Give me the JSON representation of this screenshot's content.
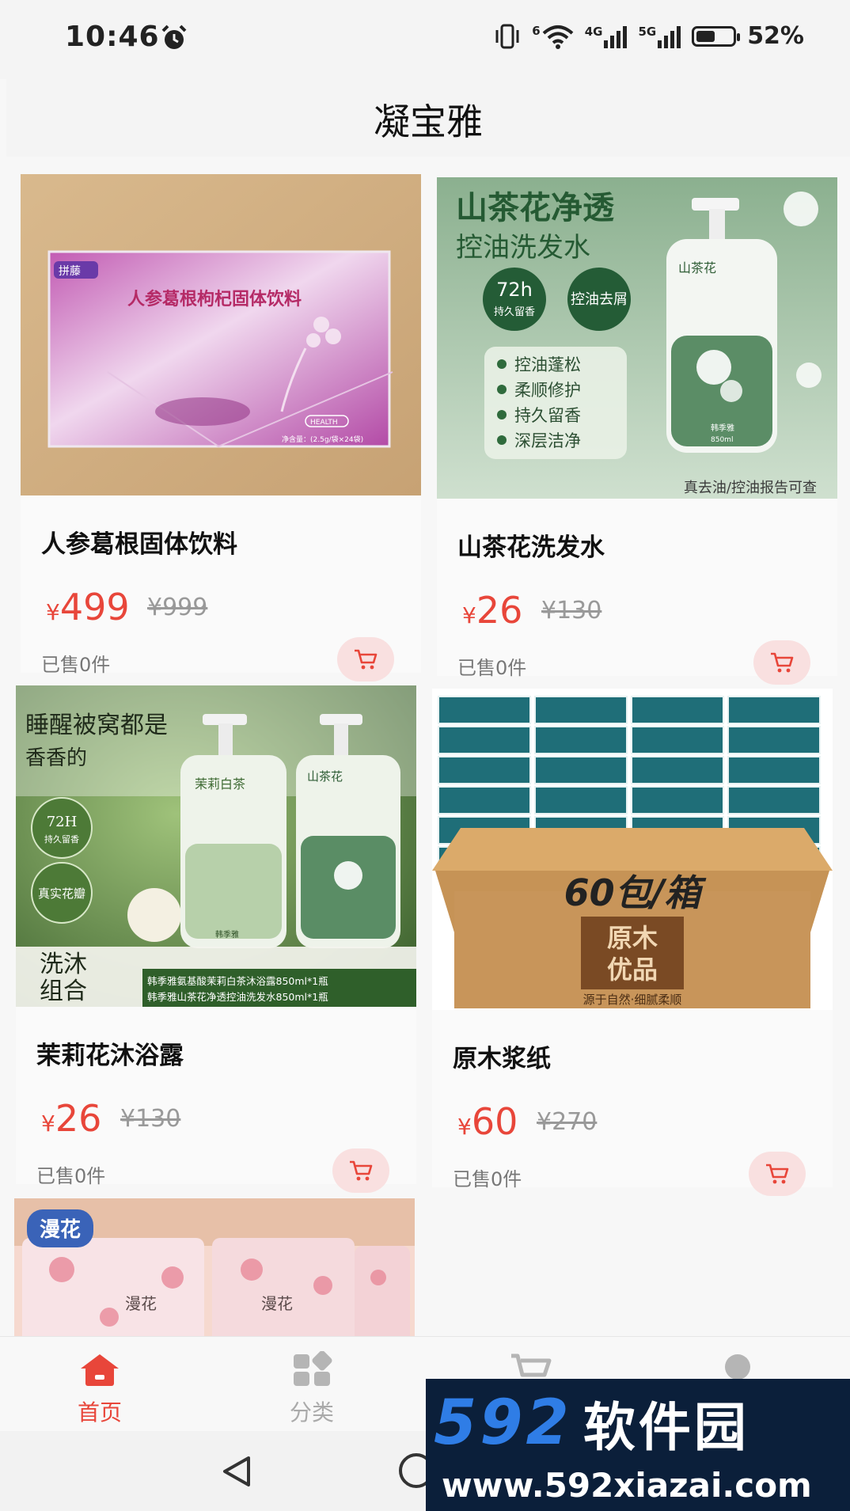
{
  "status_bar": {
    "time": "10:46",
    "network_labels": [
      "6",
      "4G",
      "5G"
    ],
    "battery_percent": "52%",
    "battery_level": 0.52
  },
  "header": {
    "title": "凝宝雅"
  },
  "currency_symbol": "¥",
  "products": [
    {
      "name": "人参葛根固体饮料",
      "price": "499",
      "original_price": "¥999",
      "sold": "已售0件",
      "image_text": {
        "box_label": "人参葛根枸杞固体饮料",
        "brand": "拼藤",
        "seal": "HEALTH",
        "net": "净含量：(2.5g/袋×24袋)"
      }
    },
    {
      "name": "山茶花洗发水",
      "price": "26",
      "original_price": "¥130",
      "sold": "已售0件",
      "image_text": {
        "headline_1": "山茶花净透",
        "headline_2": "控油洗发水",
        "badge_1_big": "72h",
        "badge_1_small": "持久留香",
        "badge_2": "控油去屑",
        "bullets": [
          "控油蓬松",
          "柔顺修护",
          "持久留香",
          "深层洁净"
        ],
        "bottle_label": "山茶花",
        "bottle_brand": "韩季雅",
        "bottle_volume": "850ml",
        "footer": "真去油/控油报告可查"
      }
    },
    {
      "name": "茉莉花沐浴露",
      "price": "26",
      "original_price": "¥130",
      "sold": "已售0件",
      "image_text": {
        "headline_1": "睡醒被窝都是",
        "headline_2": "香香的",
        "badge_1_big": "72H",
        "badge_1_small": "持久留香",
        "badge_2": "真实花瓣",
        "bottle_1": "茉莉白茶",
        "bottle_2": "山茶花",
        "bottle_brand": "韩季雅",
        "combo_1": "洗沐",
        "combo_2": "组合",
        "caption_1": "韩季雅氨基酸茉莉白茶沐浴露850ml*1瓶",
        "caption_2": "韩季雅山茶花净透控油洗发水850ml*1瓶"
      }
    },
    {
      "name": "原木浆纸",
      "price": "60",
      "original_price": "¥270",
      "sold": "已售0件",
      "image_text": {
        "banner": "60包/箱",
        "stamp_1": "原木",
        "stamp_2": "优品",
        "footer": "源于自然·细腻柔顺"
      }
    },
    {
      "name": "",
      "image_text": {
        "badge": "漫花",
        "pack_label": "漫花"
      }
    }
  ],
  "tabs": [
    {
      "label": "首页",
      "icon": "home-icon",
      "active": true
    },
    {
      "label": "分类",
      "icon": "category-icon",
      "active": false
    },
    {
      "label": "",
      "icon": "cart-icon",
      "active": false
    },
    {
      "label": "",
      "icon": "user-icon",
      "active": false
    }
  ],
  "colors": {
    "accent": "#e8463a",
    "cart_bg": "#f9e0e0",
    "inactive": "#aaaaaa"
  },
  "watermark": {
    "number": "592",
    "name": "软件园",
    "url": "www.592xiazai.com"
  }
}
